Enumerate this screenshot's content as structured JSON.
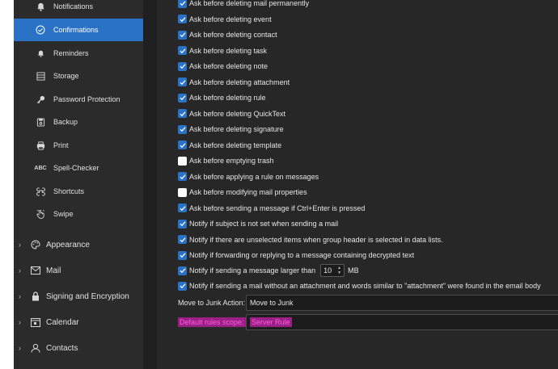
{
  "sidebar": {
    "items": [
      {
        "label": "Notifications",
        "icon": "bell-icon",
        "active": false
      },
      {
        "label": "Confirmations",
        "icon": "check-circle-icon",
        "active": true
      },
      {
        "label": "Reminders",
        "icon": "bell-small-icon",
        "active": false
      },
      {
        "label": "Storage",
        "icon": "storage-icon",
        "active": false
      },
      {
        "label": "Password Protection",
        "icon": "key-icon",
        "active": false
      },
      {
        "label": "Backup",
        "icon": "backup-icon",
        "active": false
      },
      {
        "label": "Print",
        "icon": "printer-icon",
        "active": false
      },
      {
        "label": "Spell-Checker",
        "icon": "spellcheck-icon",
        "active": false
      },
      {
        "label": "Shortcuts",
        "icon": "shortcuts-icon",
        "active": false
      },
      {
        "label": "Swipe",
        "icon": "swipe-hand-icon",
        "active": false
      }
    ],
    "groups": [
      {
        "label": "Appearance",
        "icon": "palette-icon"
      },
      {
        "label": "Mail",
        "icon": "mail-icon"
      },
      {
        "label": "Signing and Encryption",
        "icon": "lock-icon"
      },
      {
        "label": "Calendar",
        "icon": "calendar-icon"
      },
      {
        "label": "Contacts",
        "icon": "contacts-icon"
      }
    ]
  },
  "options": [
    {
      "label": "Ask before deleting mail permanently",
      "checked": true
    },
    {
      "label": "Ask before deleting event",
      "checked": true
    },
    {
      "label": "Ask before deleting contact",
      "checked": true
    },
    {
      "label": "Ask before deleting task",
      "checked": true
    },
    {
      "label": "Ask before deleting note",
      "checked": true
    },
    {
      "label": "Ask before deleting attachment",
      "checked": true
    },
    {
      "label": "Ask before deleting rule",
      "checked": true
    },
    {
      "label": "Ask before deleting QuickText",
      "checked": true
    },
    {
      "label": "Ask before deleting signature",
      "checked": true
    },
    {
      "label": "Ask before deleting template",
      "checked": true
    },
    {
      "label": "Ask before emptying trash",
      "checked": false
    },
    {
      "label": "Ask before applying a rule on messages",
      "checked": true
    },
    {
      "label": "Ask before modifying mail properties",
      "checked": false
    },
    {
      "label": "Ask before sending a message if Ctrl+Enter is pressed",
      "checked": true
    },
    {
      "label": "Notify if subject is not set when sending a mail",
      "checked": true
    },
    {
      "label": "Notify if there are unselected items when group header is selected in data lists.",
      "checked": true
    },
    {
      "label": "Notify if forwarding or replying to a message containing decrypted text",
      "checked": true
    }
  ],
  "size_option": {
    "label": "Notify if sending a message larger than",
    "checked": true,
    "value": "10",
    "unit": "MB"
  },
  "attachment_option": {
    "label": "Notify if sending a mail without an attachment and words similar to \"attachment\" were found in the email body",
    "checked": true
  },
  "junk": {
    "label": "Move to Junk Action:",
    "value": "Move to Junk"
  },
  "rules_scope": {
    "label": "Default rules scope:",
    "value": "Server Rule"
  },
  "colors": {
    "accent": "#2a72c6",
    "highlight": "#ff5fd8",
    "background": "#272727"
  }
}
